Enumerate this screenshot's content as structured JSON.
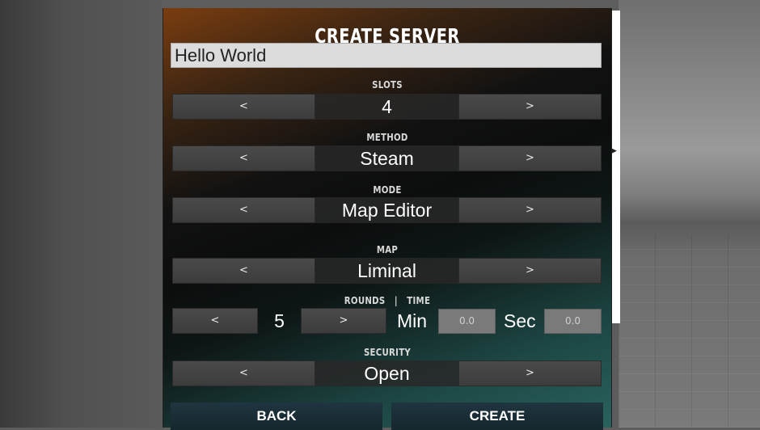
{
  "dialog": {
    "title": "CREATE SERVER",
    "server_name": "Hello World"
  },
  "slots": {
    "label": "SLOTS",
    "value": "4",
    "prev": "<",
    "next": ">"
  },
  "method": {
    "label": "METHOD",
    "value": "Steam",
    "prev": "<",
    "next": ">"
  },
  "mode": {
    "label": "MODE",
    "value": "Map Editor",
    "prev": "<",
    "next": ">"
  },
  "map": {
    "label": "MAP",
    "value": "Liminal",
    "prev": "<",
    "next": ">"
  },
  "rounds_time": {
    "label": "ROUNDS   |   TIME",
    "rounds_value": "5",
    "prev": "<",
    "next": ">",
    "min_label": "Min",
    "min_value": "0.0",
    "sec_label": "Sec",
    "sec_value": "0.0"
  },
  "security": {
    "label": "SECURITY",
    "value": "Open",
    "prev": "<",
    "next": ">"
  },
  "buttons": {
    "back": "BACK",
    "create": "CREATE"
  }
}
